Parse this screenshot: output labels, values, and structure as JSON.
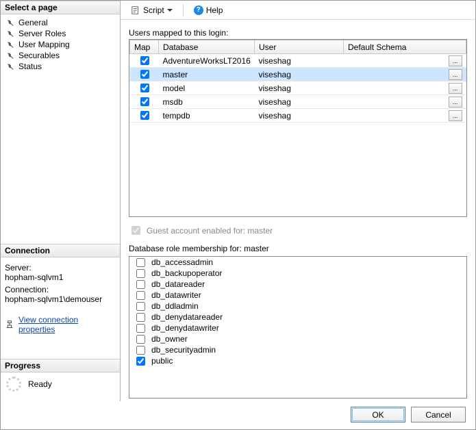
{
  "sidebar": {
    "select_page_header": "Select a page",
    "items": [
      {
        "label": "General"
      },
      {
        "label": "Server Roles"
      },
      {
        "label": "User Mapping"
      },
      {
        "label": "Securables"
      },
      {
        "label": "Status"
      }
    ],
    "connection_header": "Connection",
    "server_label": "Server:",
    "server_value": "hopham-sqlvm1",
    "conn_label": "Connection:",
    "conn_value": "hopham-sqlvm1\\demouser",
    "view_props": "View connection properties",
    "progress_header": "Progress",
    "progress_status": "Ready"
  },
  "toolbar": {
    "script": "Script",
    "help": "Help"
  },
  "mapping": {
    "label": "Users mapped to this login:",
    "columns": {
      "map": "Map",
      "db": "Database",
      "user": "User",
      "schema": "Default Schema"
    },
    "rows": [
      {
        "checked": true,
        "db": "AdventureWorksLT2016",
        "user": "viseshag",
        "schema": "",
        "selected": false
      },
      {
        "checked": true,
        "db": "master",
        "user": "viseshag",
        "schema": "",
        "selected": true
      },
      {
        "checked": true,
        "db": "model",
        "user": "viseshag",
        "schema": "",
        "selected": false
      },
      {
        "checked": true,
        "db": "msdb",
        "user": "viseshag",
        "schema": "",
        "selected": false
      },
      {
        "checked": true,
        "db": "tempdb",
        "user": "viseshag",
        "schema": "",
        "selected": false
      }
    ],
    "guest_label": "Guest account enabled for: master",
    "roles_label": "Database role membership for: master",
    "roles": [
      {
        "name": "db_accessadmin",
        "checked": false
      },
      {
        "name": "db_backupoperator",
        "checked": false
      },
      {
        "name": "db_datareader",
        "checked": false
      },
      {
        "name": "db_datawriter",
        "checked": false
      },
      {
        "name": "db_ddladmin",
        "checked": false
      },
      {
        "name": "db_denydatareader",
        "checked": false
      },
      {
        "name": "db_denydatawriter",
        "checked": false
      },
      {
        "name": "db_owner",
        "checked": false
      },
      {
        "name": "db_securityadmin",
        "checked": false
      },
      {
        "name": "public",
        "checked": true
      }
    ]
  },
  "footer": {
    "ok": "OK",
    "cancel": "Cancel"
  }
}
